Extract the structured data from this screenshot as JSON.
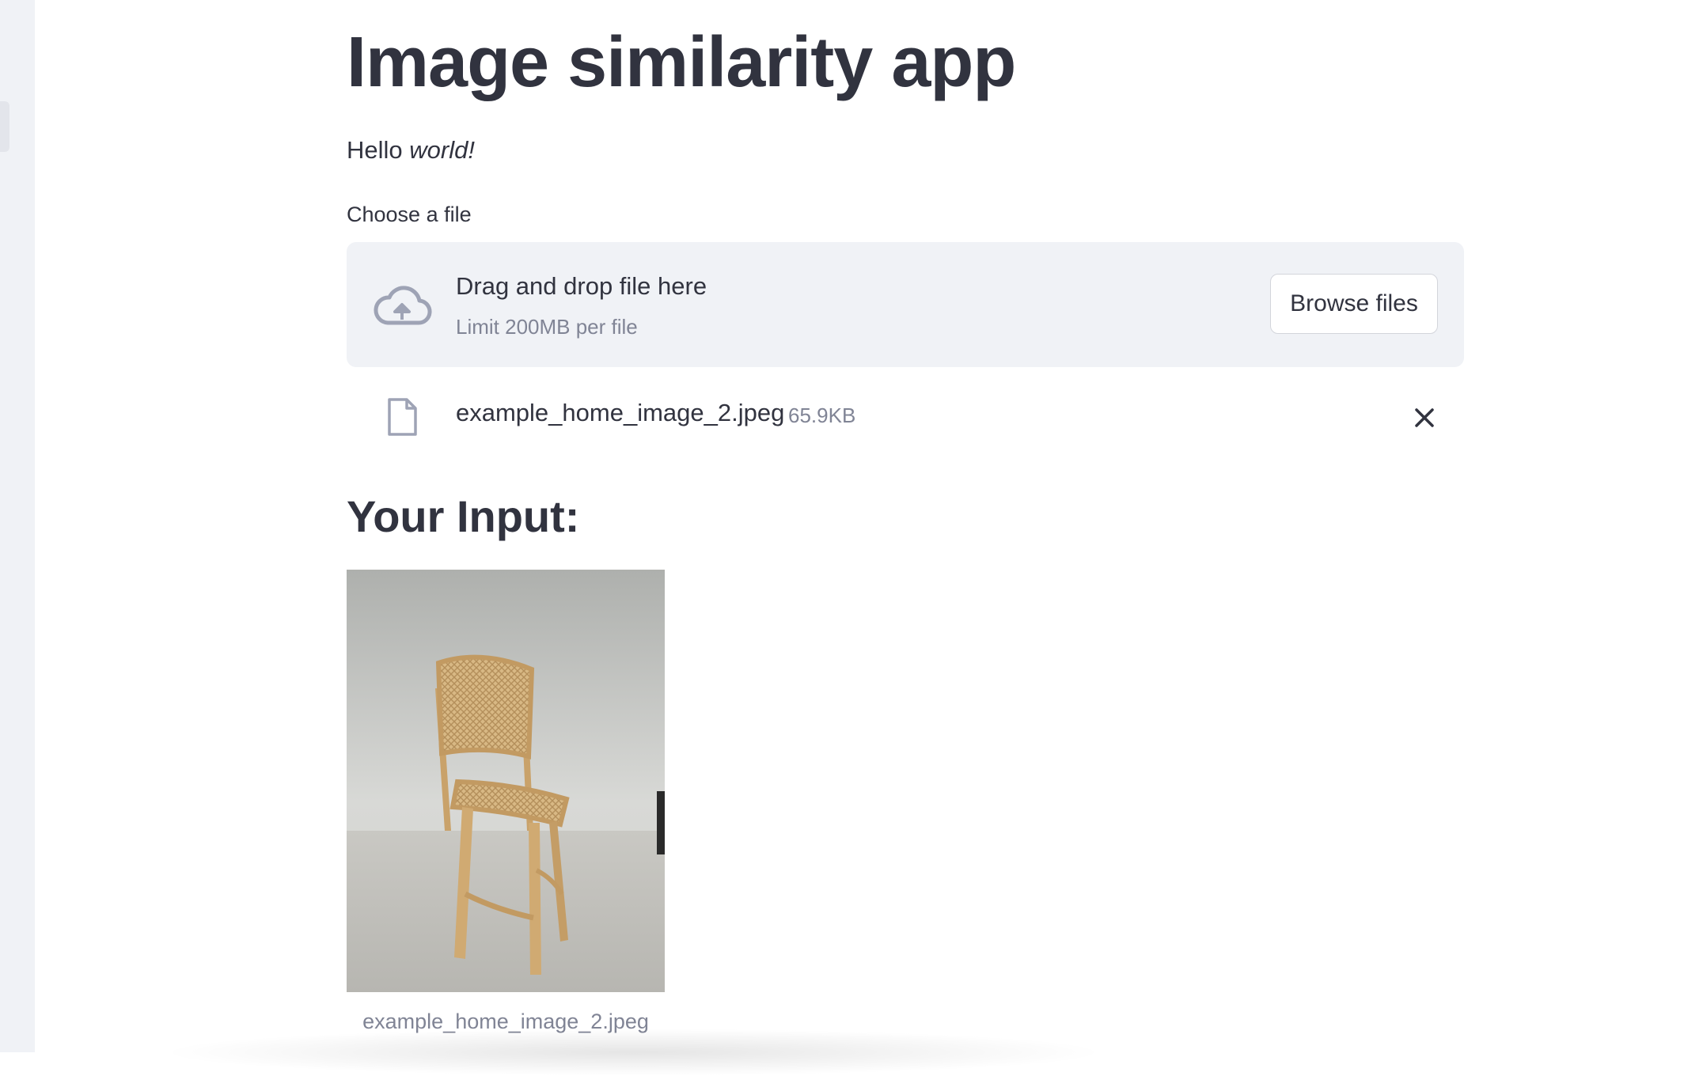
{
  "page": {
    "title": "Image similarity app",
    "greeting_prefix": "Hello",
    "greeting_emphasis": "world!"
  },
  "uploader": {
    "label": "Choose a file",
    "drop_text": "Drag and drop file here",
    "limit_text": "Limit 200MB per file",
    "browse_label": "Browse files",
    "icon": "cloud-upload-icon"
  },
  "uploaded_file": {
    "name": "example_home_image_2.jpeg",
    "size": "65.9KB",
    "icon": "file-icon",
    "remove_icon": "close-icon"
  },
  "result": {
    "heading": "Your Input:",
    "image_caption": "example_home_image_2.jpeg"
  },
  "colors": {
    "text": "#31333f",
    "muted": "#808495",
    "dropzone_bg": "#f0f2f6",
    "sidebar_bg": "#f0f2f6"
  }
}
